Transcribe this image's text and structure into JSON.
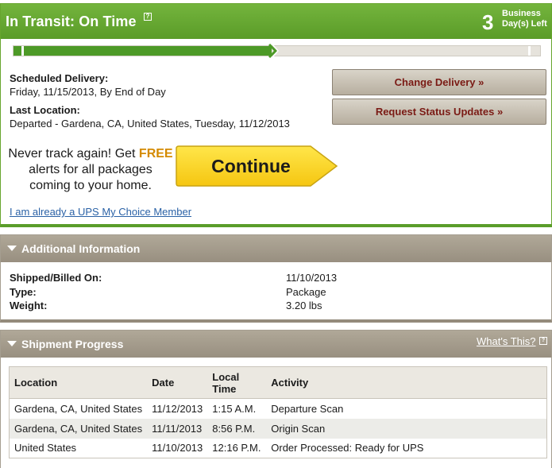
{
  "status": {
    "title": "In Transit: On Time",
    "help_glyph": "?",
    "days_left_number": "3",
    "days_left_label_line1": "Business",
    "days_left_label_line2": "Day(s) Left",
    "progress_fraction": 0.49
  },
  "delivery": {
    "scheduled_label": "Scheduled Delivery:",
    "scheduled_value": "Friday, 11/15/2013, By End of Day",
    "last_location_label": "Last Location:",
    "last_location_value": "Departed - Gardena, CA, United States, Tuesday, 11/12/2013"
  },
  "actions": {
    "change_delivery": "Change Delivery »",
    "request_status_updates": "Request Status Updates »"
  },
  "promo": {
    "line1_prefix": "Never track again! Get ",
    "line1_free": "FREE",
    "line2": "alerts for all packages",
    "line3": "coming to your home.",
    "continue_label": "Continue",
    "member_link": "I am already a UPS My Choice Member"
  },
  "additional_info": {
    "title": "Additional Information",
    "rows": [
      {
        "label": "Shipped/Billed On:",
        "value": "11/10/2013"
      },
      {
        "label": "Type:",
        "value": "Package"
      },
      {
        "label": "Weight:",
        "value": "3.20 lbs"
      }
    ]
  },
  "shipment_progress": {
    "title": "Shipment Progress",
    "whats_this": "What's This?",
    "columns": {
      "location": "Location",
      "date": "Date",
      "local_time_line1": "Local",
      "local_time_line2": "Time",
      "activity": "Activity"
    },
    "rows": [
      {
        "location": "Gardena, CA, United States",
        "date": "11/12/2013",
        "time": "1:15 A.M.",
        "activity": "Departure Scan"
      },
      {
        "location": "Gardena, CA, United States",
        "date": "11/11/2013",
        "time": "8:56 P.M.",
        "activity": "Origin Scan"
      },
      {
        "location": "United States",
        "date": "11/10/2013",
        "time": "12:16 P.M.",
        "activity": "Order Processed: Ready for UPS"
      }
    ]
  },
  "colors": {
    "status_green": "#5a9c28",
    "section_taupe": "#988f80",
    "button_text_maroon": "#7a1a14",
    "promo_yellow": "#f7d31d",
    "free_orange": "#d48a00",
    "link_blue": "#2b62a6"
  },
  "icons": {
    "help": "help-icon",
    "expand_arrow": "triangle-down-icon",
    "continue_arrow": "arrow-right-shape"
  }
}
